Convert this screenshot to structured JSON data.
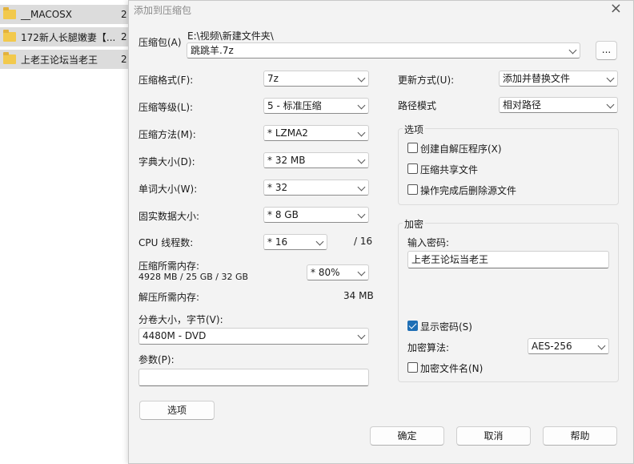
{
  "explorer": {
    "rows": [
      {
        "name": "__MACOSX",
        "size": "2"
      },
      {
        "name": "172新人长腿嫩妻【...",
        "size": "2"
      },
      {
        "name": "上老王论坛当老王",
        "size": "2"
      }
    ]
  },
  "dialog": {
    "title": "添加到压缩包",
    "close": "×",
    "archive": {
      "label": "压缩包(A)",
      "path": "E:\\视频\\新建文件夹\\",
      "name": "跳跳羊.7z",
      "browse": "..."
    },
    "format": {
      "label": "压缩格式(F):",
      "value": "7z"
    },
    "level": {
      "label": "压缩等级(L):",
      "value": "5 - 标准压缩"
    },
    "method": {
      "label": "压缩方法(M):",
      "value": "*  LZMA2"
    },
    "dict": {
      "label": "字典大小(D):",
      "value": "*  32 MB"
    },
    "word": {
      "label": "单词大小(W):",
      "value": "*  32"
    },
    "solid": {
      "label": "固实数据大小:",
      "value": "*  8 GB"
    },
    "threads": {
      "label": "CPU 线程数:",
      "value": "*  16",
      "max": "/ 16"
    },
    "mem_compress": {
      "label": "压缩所需内存:",
      "detail": "4928 MB / 25 GB / 32 GB",
      "percent": "*  80%"
    },
    "mem_decompress": {
      "label": "解压所需内存:",
      "value": "34 MB"
    },
    "volume": {
      "label": "分卷大小，字节(V):",
      "value": "4480M - DVD"
    },
    "params": {
      "label": "参数(P):",
      "value": ""
    },
    "options_button": "选项",
    "update": {
      "label": "更新方式(U):",
      "value": "添加并替换文件"
    },
    "pathmode": {
      "label": "路径模式",
      "value": "相对路径"
    },
    "options_group": {
      "title": "选项",
      "items": [
        {
          "label": "创建自解压程序(X)",
          "checked": false
        },
        {
          "label": "压缩共享文件",
          "checked": false
        },
        {
          "label": "操作完成后删除源文件",
          "checked": false
        }
      ]
    },
    "encryption": {
      "title": "加密",
      "password_label": "输入密码:",
      "password": "上老王论坛当老王",
      "show_password": {
        "label": "显示密码(S)",
        "checked": true
      },
      "method_label": "加密算法:",
      "method": "AES-256",
      "encrypt_names": {
        "label": "加密文件名(N)",
        "checked": false
      }
    },
    "buttons": {
      "ok": "确定",
      "cancel": "取消",
      "help": "帮助"
    }
  }
}
